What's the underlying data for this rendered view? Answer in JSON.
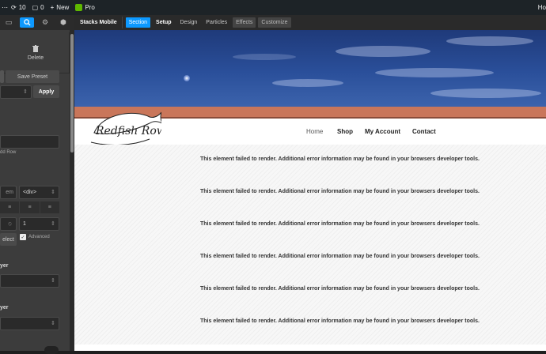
{
  "adminbar": {
    "comments_count": "0",
    "new_label": "New",
    "pro_label": "Pro",
    "right_text": "Ho"
  },
  "panel": {
    "delete_label": "Delete",
    "save_preset_label": "Save Preset",
    "apply_label": "Apply",
    "add_row_label": "dd Row",
    "unit_label": "em",
    "tag_value": "<div>",
    "number_value": "1",
    "select_label": "elect",
    "advanced_label": "Advanced",
    "layer_label_1": "yer",
    "layer_label_2": "yer"
  },
  "toolbar": {
    "breadcrumb": "Stacks Mobile",
    "tabs": [
      "Section",
      "Setup",
      "Design",
      "Particles"
    ],
    "buttons": [
      "Effects",
      "Customize"
    ]
  },
  "site": {
    "logo_text": "Redfish Row",
    "nav": [
      "Home",
      "Shop",
      "My Account",
      "Contact"
    ]
  },
  "errors": [
    "This element failed to render. Additional error information may be found in your browsers developer tools.",
    "This element failed to render. Additional error information may be found in your browsers developer tools.",
    "This element failed to render. Additional error information may be found in your browsers developer tools.",
    "This element failed to render. Additional error information may be found in your browsers developer tools.",
    "This element failed to render. Additional error information may be found in your browsers developer tools.",
    "This element failed to render. Additional error information may be found in your browsers developer tools."
  ],
  "colors": {
    "accent": "#0d99ff",
    "orange_band": "#c9765a",
    "pro_green": "#5fb800"
  }
}
